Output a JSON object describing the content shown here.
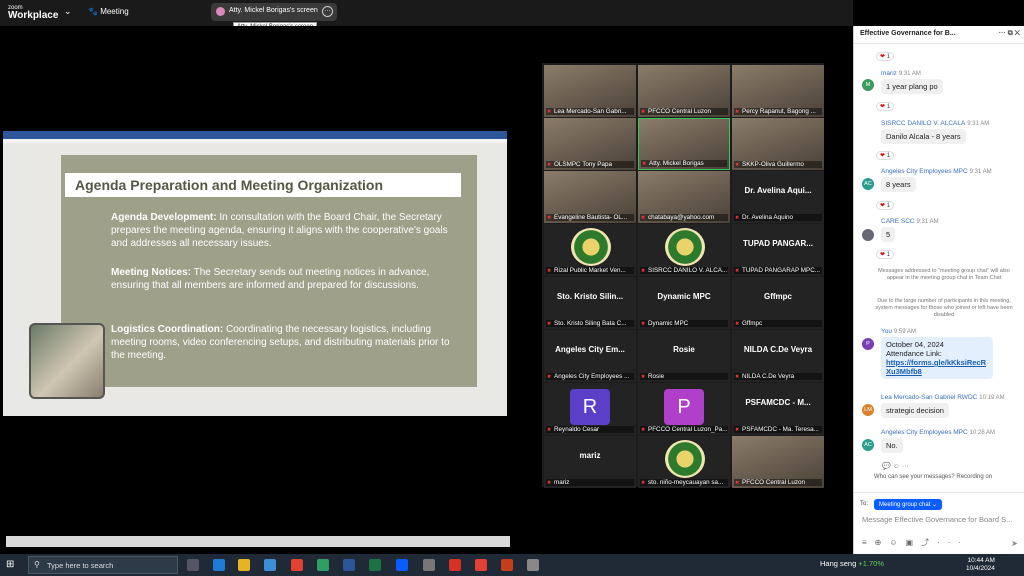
{
  "app": {
    "logo_line1": "zoom",
    "logo_line2": "Workplace",
    "meeting_tab": "Meeting"
  },
  "share": {
    "label": "Atty. Mickel Borigas's screen",
    "tooltip": "Atty. Mickel Borigas's screen"
  },
  "slide": {
    "title": "Agenda Preparation and Meeting Organization",
    "p1_head": "Agenda Development:",
    "p1_body": " In consultation with the Board Chair, the Secretary prepares the meeting agenda, ensuring it aligns with the cooperative's goals and addresses all necessary issues.",
    "p2_head": "Meeting Notices:",
    "p2_body": " The Secretary sends out meeting notices in advance, ensuring that all members are informed and prepared for discussions.",
    "p3_head": "Logistics Coordination:",
    "p3_body": " Coordinating the necessary logistics, including meeting rooms, video conferencing setups, and distributing materials prior to the meeting."
  },
  "participants": [
    {
      "caption": "Lea Mercado-San Gabri...",
      "big": ""
    },
    {
      "caption": "PFCCO Central Luzon",
      "big": ""
    },
    {
      "caption": "Percy Rapanut, Bagong ...",
      "big": ""
    },
    {
      "caption": "OLSMPC Tony Papa",
      "big": ""
    },
    {
      "caption": "Atty. Mickel Borigas",
      "big": ""
    },
    {
      "caption": "SKKP-Oliva Guillermo",
      "big": ""
    },
    {
      "caption": "Evangeline Bautista- OL...",
      "big": ""
    },
    {
      "caption": "chatabaya@yahoo.com",
      "big": ""
    },
    {
      "caption": "Dr. Avelina Aquino",
      "big": "Dr. Avelina Aqui..."
    },
    {
      "caption": "Rizal Public Market Ven...",
      "big": ""
    },
    {
      "caption": "SISRCC DANILO V. ALCA...",
      "big": ""
    },
    {
      "caption": "TUPAD PANGARAP MPC...",
      "big": "TUPAD PANGAR..."
    },
    {
      "caption": "Sto. Kristo Siling Bata C...",
      "big": "Sto. Kristo Silin..."
    },
    {
      "caption": "Dynamic MPC",
      "big": "Dynamic MPC"
    },
    {
      "caption": "Gffmpc",
      "big": "Gffmpc"
    },
    {
      "caption": "Angeles City Employees ...",
      "big": "Angeles City Em..."
    },
    {
      "caption": "Rosie",
      "big": "Rosie"
    },
    {
      "caption": "NILDA C.De Veyra",
      "big": "NILDA C.De Veyra"
    },
    {
      "caption": "Reynaldo Cesar",
      "big": "R"
    },
    {
      "caption": "PFCCO Central Luzon_Pa...",
      "big": "P"
    },
    {
      "caption": "PSFAMCDC - Ma. Teresa...",
      "big": "PSFAMCDC - M..."
    },
    {
      "caption": "mariz",
      "big": "mariz"
    },
    {
      "caption": "sto. niño-meycauayan sa...",
      "big": ""
    },
    {
      "caption": "PFCCO Central Luzon",
      "big": ""
    }
  ],
  "chat": {
    "title": "Effective Governance for B...",
    "messages": [
      {
        "name": "mariz",
        "time": "9:31 AM",
        "text": "1 year plang po",
        "avatar": "M"
      },
      {
        "name": "SISRCC DANILO V. ALCALA",
        "time": "9:31 AM",
        "text": "Danilo Alcala - 8 years",
        "avatar": ""
      },
      {
        "name": "Angeles City Employees MPC",
        "time": "9:31 AM",
        "text": "8 years",
        "avatar": "AC"
      },
      {
        "name": "CARE SCC",
        "time": "9:31 AM",
        "text": "5",
        "avatar": ""
      },
      {
        "name": "Lea Mercado-San Gabriel RWDC",
        "time": "10:19 AM",
        "text": "strategic decision",
        "avatar": "LM"
      },
      {
        "name": "Angeles City Employees MPC",
        "time": "10:28 AM",
        "text": "No.",
        "avatar": "AC"
      }
    ],
    "react_count": "1",
    "note1": "Messages addressed to \"meeting group chat\" will also appear in the meeting group chat in Team Chat",
    "note2": "Due to the large number of participants in this meeting, system messages for those who joined or left have been disabled",
    "mine": {
      "name": "You",
      "time": "9:59 AM",
      "line1": "October 04, 2024",
      "line2": "Attendance Link:",
      "link": "https://forms.gle/kKksiRecRXu3Mbfb8",
      "avatar": "P"
    },
    "who_can_see": "Who can see your messages? Recording on",
    "to_label": "To:",
    "to_target": "Meeting group chat ⌄",
    "input_placeholder": "Message Effective Governance for Board S..."
  },
  "taskbar": {
    "search_placeholder": "Type here to search",
    "weather_text": "Hang seng",
    "weather_pct": "+1.70%",
    "time": "10:44 AM",
    "date": "10/4/2024"
  }
}
